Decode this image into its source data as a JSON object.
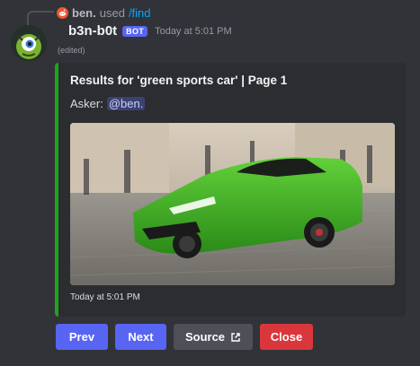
{
  "command": {
    "user": "ben.",
    "verb": "used",
    "name": "/find"
  },
  "message": {
    "username": "b3n-b0t",
    "badge": "BOT",
    "timestamp": "Today at 5:01 PM",
    "edited": "(edited)"
  },
  "embed": {
    "accent_color": "#1fa21f",
    "title": "Results for 'green sports car' | Page 1",
    "asker_label": "Asker:",
    "asker_mention": "@ben.",
    "footer": "Today at 5:01 PM"
  },
  "buttons": {
    "prev": "Prev",
    "next": "Next",
    "source": "Source",
    "close": "Close"
  },
  "colors": {
    "primary": "#5865f2",
    "secondary": "#4e5058",
    "danger": "#da373c"
  }
}
